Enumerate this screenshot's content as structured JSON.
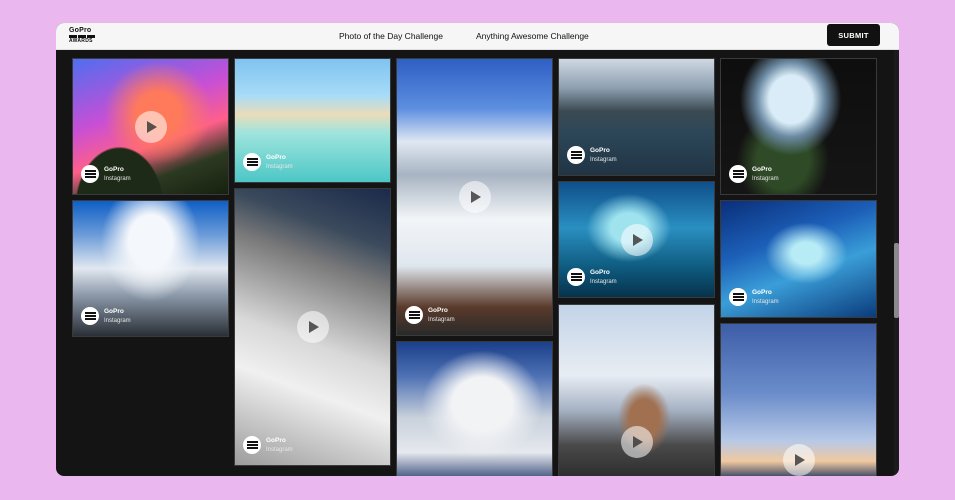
{
  "header": {
    "logo_top": "GoPro",
    "logo_bottom": "AWARDS",
    "nav": [
      {
        "label": "Photo of the Day Challenge"
      },
      {
        "label": "Anything Awesome Challenge"
      }
    ],
    "submit_label": "SUBMIT"
  },
  "gallery": {
    "tiles": [
      {
        "name": "GoPro",
        "source": "Instagram",
        "video": true
      },
      {
        "name": "GoPro",
        "source": "Instagram",
        "video": false
      },
      {
        "name": "GoPro",
        "source": "Instagram",
        "video": true
      },
      {
        "name": "GoPro",
        "source": "Instagram",
        "video": false
      },
      {
        "name": "GoPro",
        "source": "Instagram",
        "video": false
      },
      {
        "name": "GoPro",
        "source": "Instagram",
        "video": false
      },
      {
        "name": "GoPro",
        "source": "Instagram",
        "video": true
      },
      {
        "name": "GoPro",
        "source": "Instagram",
        "video": true
      },
      {
        "name": "GoPro",
        "source": "Instagram",
        "video": false
      },
      {
        "name": "",
        "source": "",
        "video": false
      },
      {
        "name": "",
        "source": "",
        "video": true
      },
      {
        "name": "",
        "source": "",
        "video": true
      }
    ]
  },
  "colors": {
    "page_bg": "#eab8ef",
    "gallery_bg": "#141414",
    "submit_bg": "#111111"
  }
}
